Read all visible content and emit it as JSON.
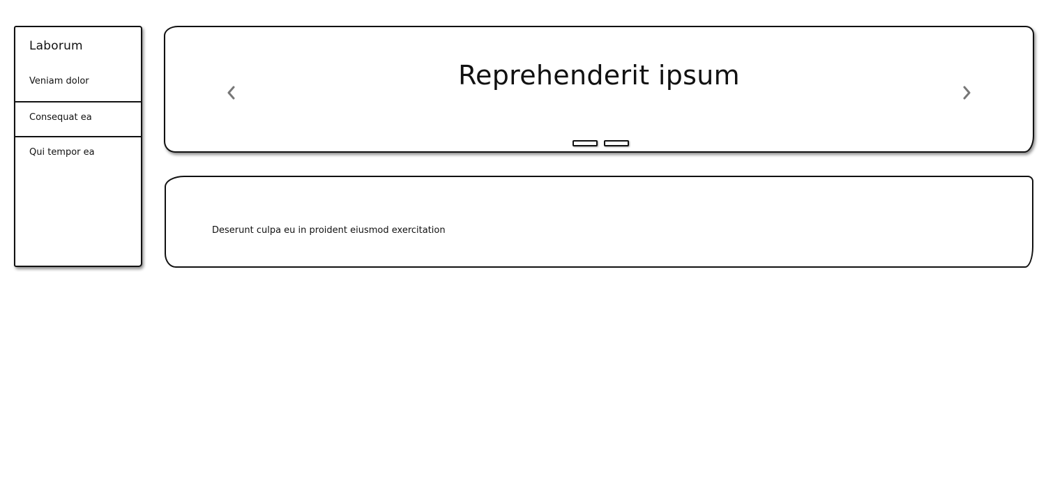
{
  "sidebar": {
    "title": "Laborum",
    "items": [
      {
        "label": "Veniam dolor"
      },
      {
        "label": "Consequat ea"
      },
      {
        "label": "Qui tempor ea"
      }
    ]
  },
  "carousel": {
    "title": "Reprehenderit ipsum",
    "prev_icon": "chevron-left-icon",
    "next_icon": "chevron-right-icon",
    "indicator_count": 2,
    "arrow_color": "#777777"
  },
  "content": {
    "text": "Deserunt culpa eu in proident eiusmod exercitation"
  }
}
